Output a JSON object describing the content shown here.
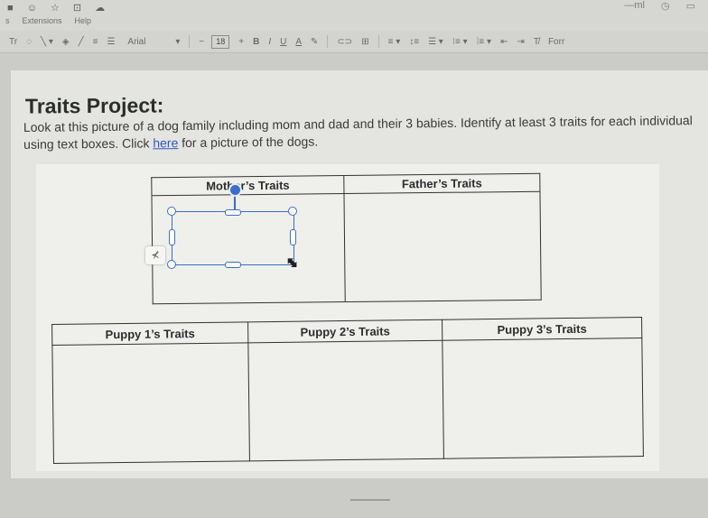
{
  "menubar": {
    "title_icons": "■ ☺ ☆ ⊡ ☁",
    "menu_items": [
      "s",
      "Extensions",
      "Help"
    ],
    "right_icons": [
      "—ml",
      "◷",
      "▭"
    ]
  },
  "toolbar": {
    "items": [
      "Tr",
      "◌",
      "╲ ▾",
      "◈",
      "╱",
      "≡",
      "☰"
    ],
    "font": "Arial",
    "font_caret": "▾",
    "minus": "−",
    "font_size": "18",
    "plus": "+",
    "bold": "B",
    "italic": "I",
    "underline": "U",
    "text_color": "A",
    "highlight": "✎",
    "link": "⊂⊃",
    "comment": "⊞",
    "align": "≡ ▾",
    "line_spacing": "↕≡",
    "checklist": "☰ ▾",
    "bullets": "⁝≡ ▾",
    "numbered": "⁞≡ ▾",
    "indent_less": "⇤",
    "indent_more": "⇥",
    "clear": "T̸",
    "format_options": "Forr"
  },
  "document": {
    "title": "Traits Project:",
    "paragraph_before_link": "Look at this picture of a dog family including mom and dad and their 3 babies.  Identify at least 3 traits for each individual using text boxes.  Click ",
    "link_text": "here",
    "paragraph_after_link": " for a picture of the dogs."
  },
  "parents_table": {
    "headers": [
      "Mother’s Traits",
      "Father’s Traits"
    ]
  },
  "puppies_table": {
    "headers": [
      "Puppy 1’s Traits",
      "Puppy 2’s Traits",
      "Puppy 3’s Traits"
    ]
  },
  "side_chip_icon": "⊀",
  "colors": {
    "selection": "#3a6fc9",
    "link": "#2f58c4",
    "border": "#303234"
  }
}
